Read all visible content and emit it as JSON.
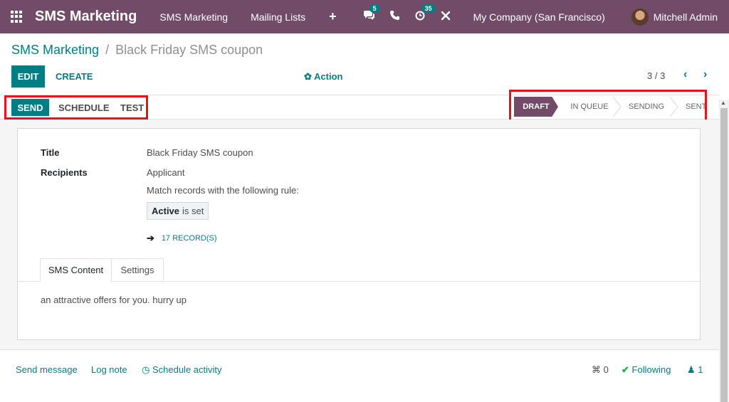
{
  "navbar": {
    "brand": "SMS Marketing",
    "menu": [
      "SMS Marketing",
      "Mailing Lists"
    ],
    "plus": "+",
    "messages_count": "5",
    "activities_count": "35",
    "company": "My Company (San Francisco)",
    "user": "Mitchell Admin"
  },
  "breadcrumb": {
    "parent": "SMS Marketing",
    "separator": "/",
    "current": "Black Friday SMS coupon"
  },
  "control": {
    "edit": "EDIT",
    "create": "CREATE",
    "action": "Action",
    "pager": "3 / 3"
  },
  "statusbar": {
    "buttons": [
      "SEND",
      "SCHEDULE",
      "TEST"
    ],
    "stages": [
      "DRAFT",
      "IN QUEUE",
      "SENDING",
      "SENT"
    ],
    "active_stage": "DRAFT"
  },
  "form": {
    "title_label": "Title",
    "title_value": "Black Friday SMS coupon",
    "recipients_label": "Recipients",
    "recipients_value": "Applicant",
    "rule_text": "Match records with the following rule:",
    "rule_field": "Active",
    "rule_op": "is set",
    "records_link": "17 RECORD(S)",
    "tabs": [
      "SMS Content",
      "Settings"
    ],
    "sms_body": "an attractive offers for you. hurry up"
  },
  "chatter": {
    "send_message": "Send message",
    "log_note": "Log note",
    "schedule_activity": "Schedule activity",
    "attachments_count": "0",
    "following": "Following",
    "followers_count": "1"
  },
  "colors": {
    "brand": "#714b67",
    "accent": "#017e84",
    "highlight": "#e3141e"
  }
}
